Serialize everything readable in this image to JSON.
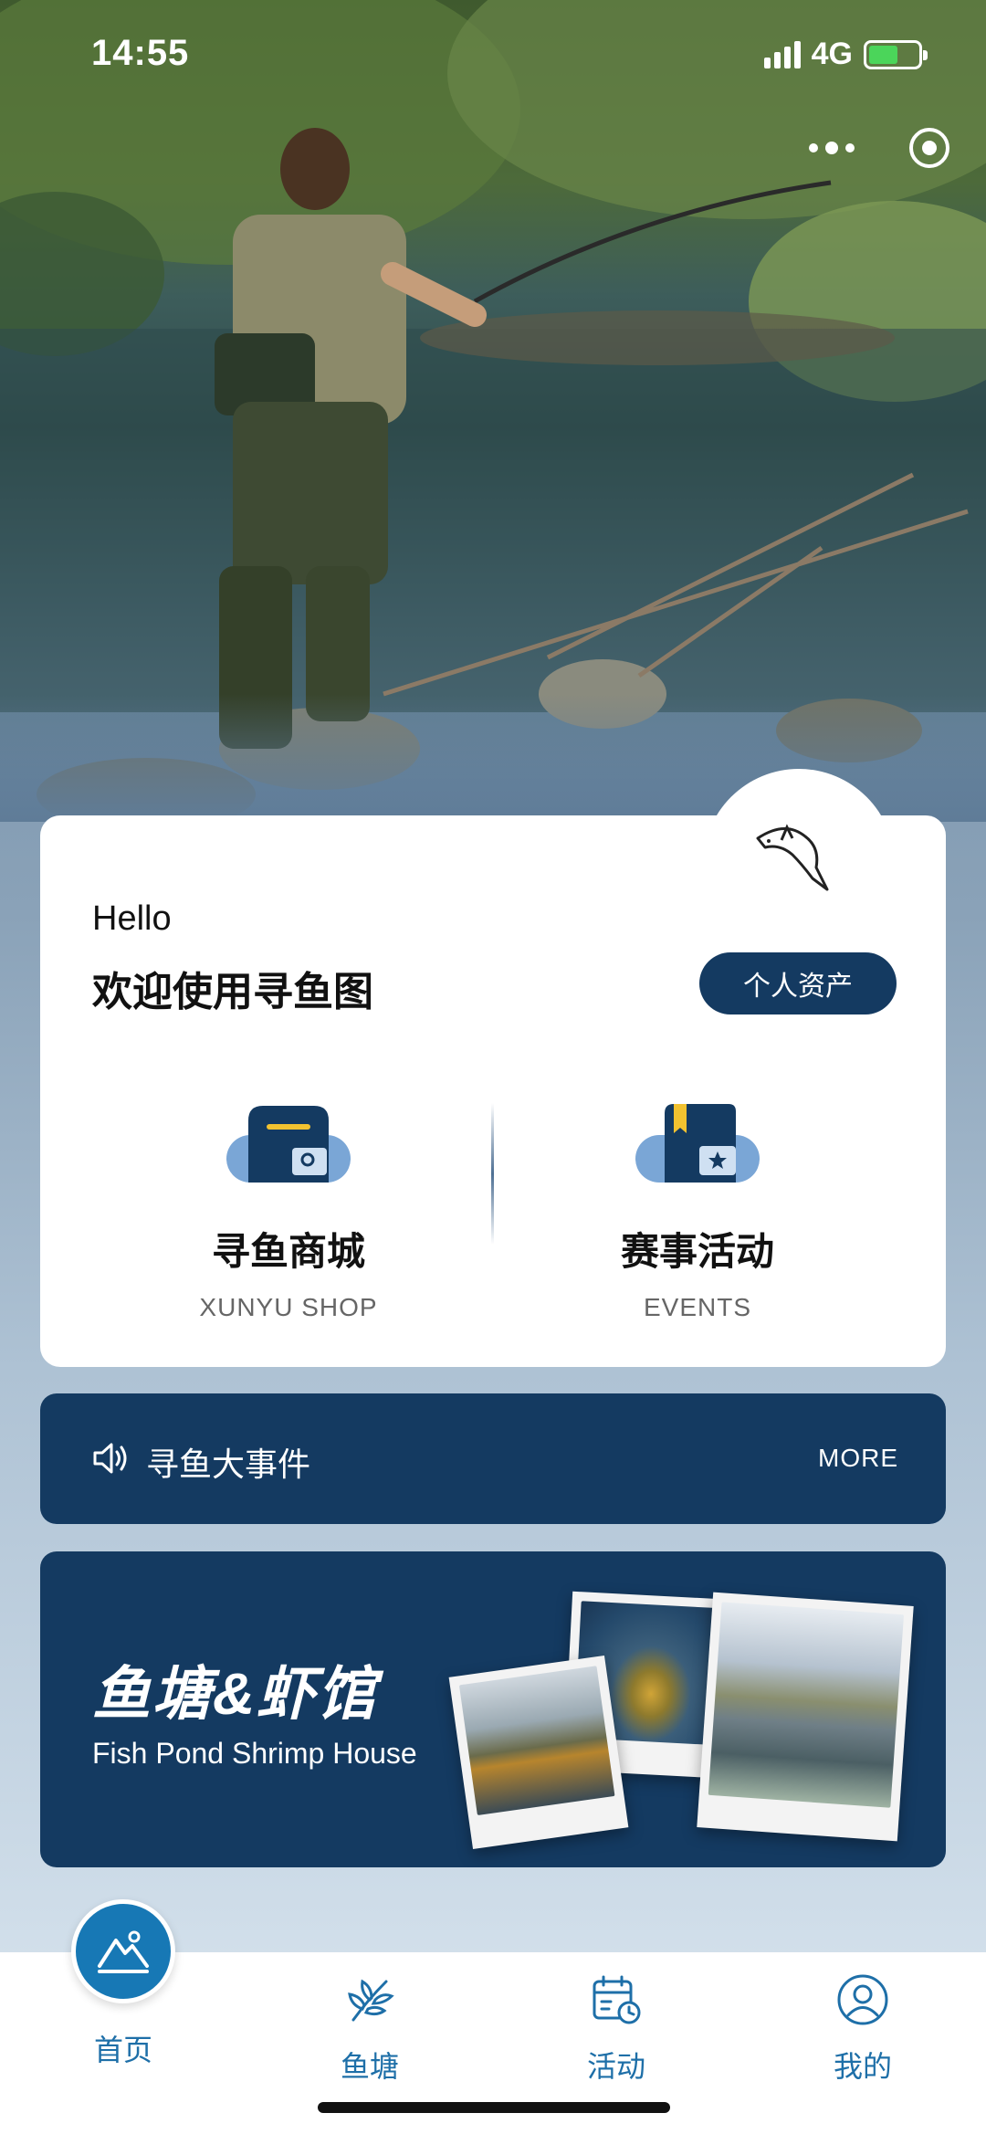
{
  "status_bar": {
    "time": "14:55",
    "network": "4G",
    "icons": [
      "signal-icon",
      "battery-charging-icon"
    ]
  },
  "capsule": {
    "icons": [
      "more-dots-icon",
      "close-target-icon"
    ]
  },
  "welcome_card": {
    "greeting": "Hello",
    "title": "欢迎使用寻鱼图",
    "assets_button": "个人资产",
    "mascot_icon": "dolphin-icon",
    "features": [
      {
        "title": "寻鱼商城",
        "subtitle": "XUNYU SHOP",
        "icon": "shop-icon"
      },
      {
        "title": "赛事活动",
        "subtitle": "EVENTS",
        "icon": "events-icon"
      }
    ]
  },
  "news_bar": {
    "label": "寻鱼大事件",
    "more": "MORE",
    "icon": "speaker-icon"
  },
  "banner": {
    "title": "鱼塘&虾馆",
    "subtitle": "Fish Pond Shrimp House"
  },
  "tabbar": {
    "items": [
      {
        "label": "首页",
        "icon": "mountain-home-icon",
        "active": true
      },
      {
        "label": "鱼塘",
        "icon": "leaf-icon"
      },
      {
        "label": "活动",
        "icon": "calendar-clock-icon"
      },
      {
        "label": "我的",
        "icon": "user-icon"
      }
    ]
  },
  "colors": {
    "primary": "#143a61",
    "accent": "#1778b5",
    "tab_text": "#1e6fa8"
  }
}
